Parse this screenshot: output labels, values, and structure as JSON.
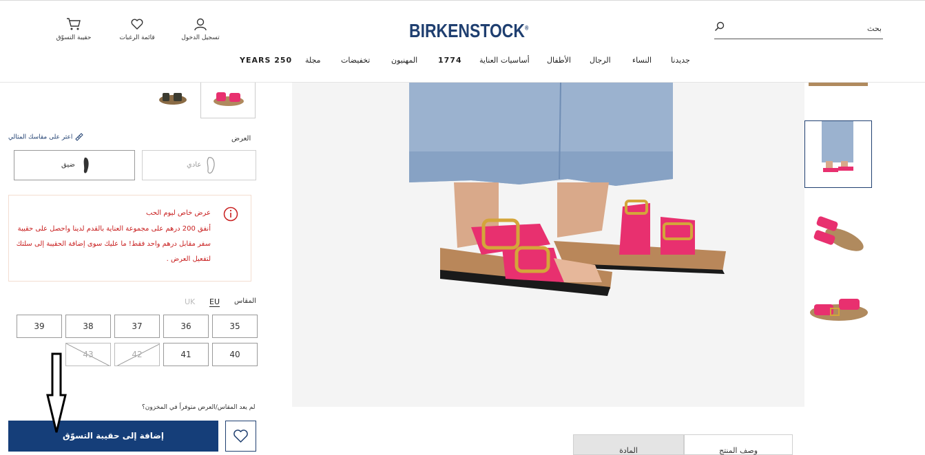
{
  "header": {
    "logo": "BIRKENSTOCK",
    "logo_mark": "®",
    "search_placeholder": "بحث",
    "cart_label": "حقيبة التسوّق",
    "wishlist_label": "قائمة الرغبات",
    "login_label": "تسجيل الدخول",
    "nav": [
      "جديدنا",
      "النساء",
      "الرجال",
      "الأطفال",
      "أساسيات العناية",
      "1774",
      "المهنيون",
      "تخفيضات",
      "مجلة",
      "YEARS 250"
    ]
  },
  "product": {
    "width_label": "العرض",
    "find_size_link": "اعثر على مقاسك المثالي",
    "width_options": [
      {
        "label": "عادي",
        "state": "disabled"
      },
      {
        "label": "ضيق",
        "state": "selected"
      }
    ],
    "offer": {
      "title": "عرض خاص ليوم الحب",
      "body": "أنفق 200 درهم على مجموعة العناية بالقدم لدينا واحصل على حقيبة سفر مقابل درهم واحد فقط! ما عليك سوى إضافة الحقيبة إلى سلتك لتفعيل العرض ."
    },
    "size_label": "المقاس",
    "size_systems": {
      "eu": "EU",
      "uk": "UK"
    },
    "sizes_row1": [
      "35",
      "36",
      "37",
      "38",
      "39"
    ],
    "sizes_row2": [
      "40",
      "41",
      "42",
      "43"
    ],
    "unavailable_sizes": [
      "42",
      "43"
    ],
    "out_of_stock_link": "لم يعد المقاس/العرض متوفراً في المخزون؟",
    "add_to_bag": "إضافة إلى حقيبة التسوّق"
  },
  "tabs": [
    "وصف المنتج",
    "المادة"
  ],
  "colors": {
    "brand": "#1f3f70",
    "button": "#153e79",
    "offer_text": "#c81e1e",
    "sandal_pink": "#e8306f"
  }
}
